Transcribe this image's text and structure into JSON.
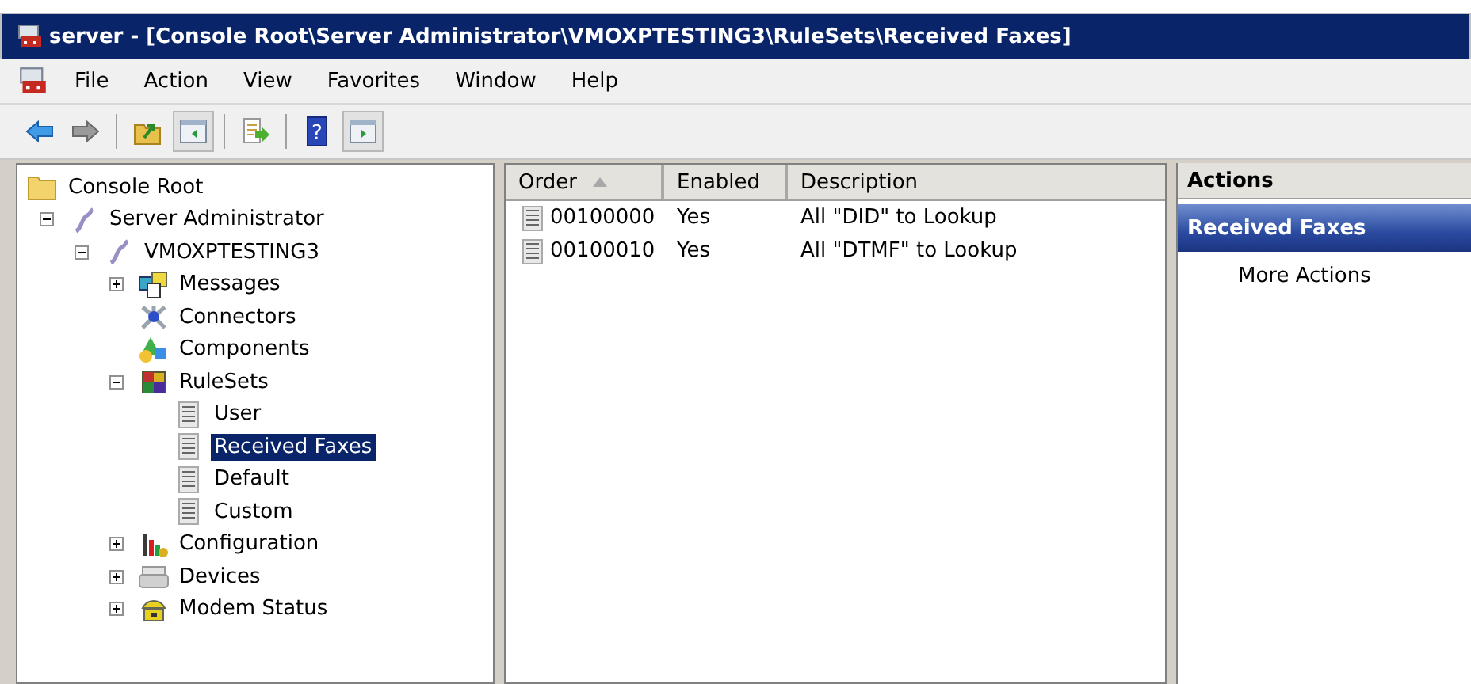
{
  "window": {
    "title": "server - [Console Root\\Server Administrator\\VMOXPTESTING3\\RuleSets\\Received Faxes]"
  },
  "menu": [
    "File",
    "Action",
    "View",
    "Favorites",
    "Window",
    "Help"
  ],
  "toolbar": [
    {
      "kind": "back",
      "pressed": false
    },
    {
      "kind": "forward",
      "pressed": false
    },
    {
      "kind": "sep"
    },
    {
      "kind": "up",
      "pressed": false
    },
    {
      "kind": "tree",
      "pressed": true
    },
    {
      "kind": "sep"
    },
    {
      "kind": "export",
      "pressed": false
    },
    {
      "kind": "sep"
    },
    {
      "kind": "help",
      "pressed": false,
      "glyph": "?"
    },
    {
      "kind": "actions",
      "pressed": true
    }
  ],
  "tree": [
    {
      "label": "Console Root",
      "kind": "folder",
      "selected": false,
      "children": [
        {
          "label": "Server Administrator",
          "kind": "snapin",
          "expanded": true,
          "selected": false,
          "children": [
            {
              "label": "VMOXPTESTING3",
              "kind": "snapin",
              "expanded": true,
              "selected": false,
              "children": [
                {
                  "label": "Messages",
                  "kind": "messages",
                  "expanded": false,
                  "selected": false
                },
                {
                  "label": "Connectors",
                  "kind": "connectors",
                  "selected": false
                },
                {
                  "label": "Components",
                  "kind": "components",
                  "selected": false
                },
                {
                  "label": "RuleSets",
                  "kind": "rulesets",
                  "expanded": true,
                  "selected": false,
                  "children": [
                    {
                      "label": "User",
                      "kind": "ruleset",
                      "selected": false
                    },
                    {
                      "label": "Received Faxes",
                      "kind": "ruleset",
                      "selected": true
                    },
                    {
                      "label": "Default",
                      "kind": "ruleset",
                      "selected": false
                    },
                    {
                      "label": "Custom",
                      "kind": "ruleset",
                      "selected": false
                    }
                  ]
                },
                {
                  "label": "Configuration",
                  "kind": "configuration",
                  "expanded": false,
                  "selected": false
                },
                {
                  "label": "Devices",
                  "kind": "devices",
                  "expanded": false,
                  "selected": false
                },
                {
                  "label": "Modem Status",
                  "kind": "modem",
                  "expanded": false,
                  "selected": false
                }
              ]
            }
          ]
        }
      ]
    }
  ],
  "table": {
    "columns": [
      {
        "label": "Order",
        "sorted": true
      },
      {
        "label": "Enabled",
        "sorted": false
      },
      {
        "label": "Description",
        "sorted": false
      }
    ],
    "rows": [
      {
        "order": "00100000",
        "enabled": "Yes",
        "description": "All \"DID\" to Lookup"
      },
      {
        "order": "00100010",
        "enabled": "Yes",
        "description": "All \"DTMF\" to Lookup"
      }
    ]
  },
  "actions": {
    "title": "Actions",
    "section": "Received Faxes",
    "items": [
      "More Actions"
    ]
  }
}
